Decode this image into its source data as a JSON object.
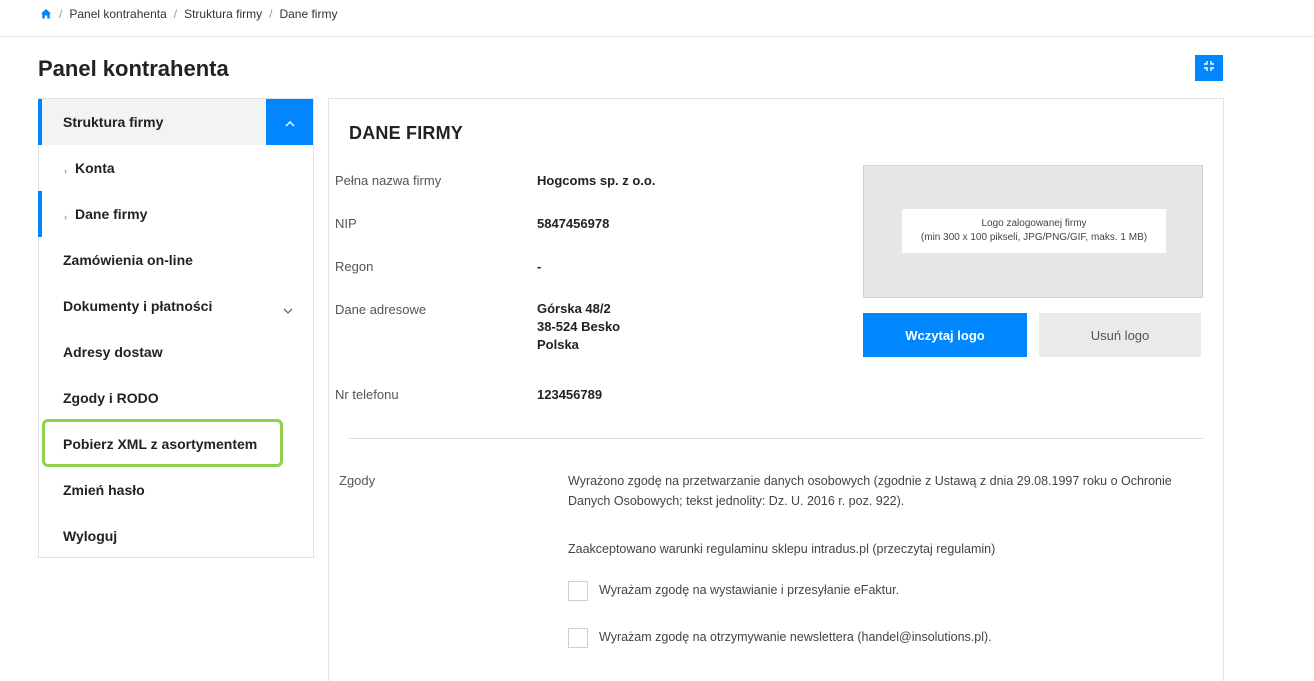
{
  "breadcrumb": {
    "items": [
      "Panel kontrahenta",
      "Struktura firmy",
      "Dane firmy"
    ]
  },
  "page": {
    "title": "Panel kontrahenta"
  },
  "icons": {
    "home": "home-icon",
    "expand": "fullscreen-icon",
    "collapse": "chevron-up-icon",
    "expand_section": "chevron-down-icon"
  },
  "colors": {
    "accent": "#0087ff",
    "highlight": "#8fd14f"
  },
  "sidebar": {
    "items": [
      {
        "label": "Struktura firmy"
      },
      {
        "label": "Konta"
      },
      {
        "label": "Dane firmy"
      },
      {
        "label": "Zamówienia on-line"
      },
      {
        "label": "Dokumenty i płatności"
      },
      {
        "label": "Adresy dostaw"
      },
      {
        "label": "Zgody i RODO"
      },
      {
        "label": "Pobierz XML z asortymentem"
      },
      {
        "label": "Zmień hasło"
      },
      {
        "label": "Wyloguj"
      }
    ]
  },
  "company": {
    "section_title": "DANE FIRMY",
    "fields": [
      {
        "label": "Pełna nazwa firmy",
        "value": "Hogcoms sp. z o.o."
      },
      {
        "label": "NIP",
        "value": "5847456978"
      },
      {
        "label": "Regon",
        "value": "-"
      },
      {
        "label": "Dane adresowe",
        "lines": [
          "Górska 48/2",
          "38-524 Besko",
          "Polska"
        ]
      },
      {
        "label": "Nr telefonu",
        "value": "123456789"
      }
    ],
    "logo": {
      "hint_line1": "Logo zalogowanej firmy",
      "hint_line2": "(min 300 x 100 pikseli, JPG/PNG/GIF, maks. 1 MB)",
      "upload_label": "Wczytaj logo",
      "remove_label": "Usuń logo"
    }
  },
  "consents": {
    "label": "Zgody",
    "text1": "Wyrażono zgodę na przetwarzanie danych osobowych (zgodnie z Ustawą z dnia 29.08.1997 roku o Ochronie Danych Osobowych; tekst jednolity: Dz. U. 2016 r. poz. 922).",
    "text2": "Zaakceptowano warunki regulaminu sklepu intradus.pl (przeczytaj regulamin)",
    "checkboxes": [
      {
        "label": "Wyrażam zgodę na wystawianie i przesyłanie eFaktur.",
        "checked": false
      },
      {
        "label": "Wyrażam zgodę na otrzymywanie newslettera (handel@insolutions.pl).",
        "checked": false
      }
    ]
  }
}
